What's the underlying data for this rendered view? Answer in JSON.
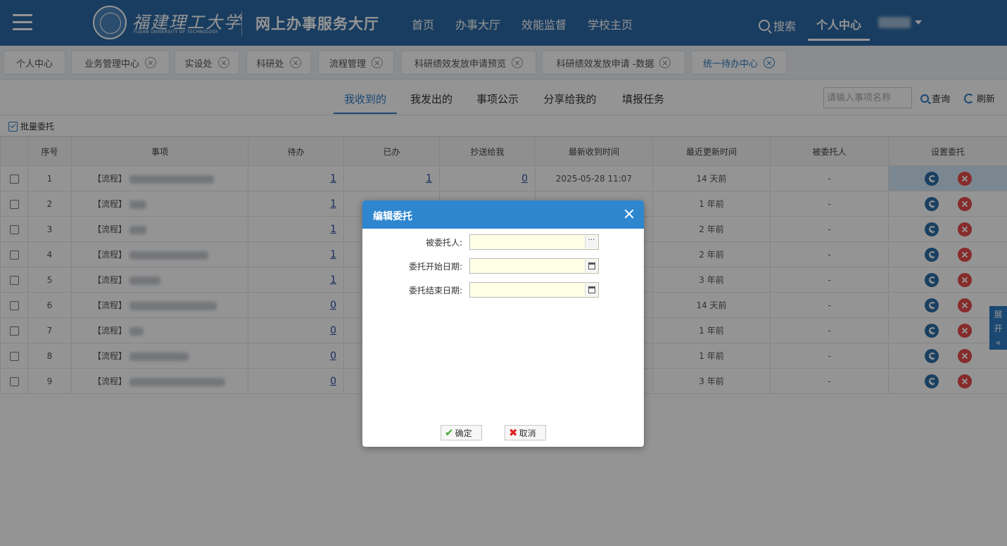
{
  "header": {
    "logo_cn": "福建理工大学",
    "logo_en": "FUJIAN UNIVERSITY OF TECHNOLOGY",
    "app_title": "网上办事服务大厅",
    "nav": [
      "首页",
      "办事大厅",
      "效能监督",
      "学校主页"
    ],
    "search_label": "搜索",
    "personal_center": "个人中心"
  },
  "tabs": [
    {
      "label": "个人中心",
      "closable": false
    },
    {
      "label": "业务管理中心",
      "closable": true
    },
    {
      "label": "实设处",
      "closable": true
    },
    {
      "label": "科研处",
      "closable": true
    },
    {
      "label": "流程管理",
      "closable": true
    },
    {
      "label": "科研绩效发放申请预览",
      "closable": true
    },
    {
      "label": "科研绩效发放申请 -数据",
      "closable": true
    },
    {
      "label": "统一待办中心",
      "closable": true,
      "active": true
    }
  ],
  "subnav": {
    "tabs": [
      "我收到的",
      "我发出的",
      "事项公示",
      "分享给我的",
      "填报任务"
    ],
    "active": "我收到的",
    "search_placeholder": "请输入事项名称",
    "query_label": "查询",
    "refresh_label": "刷新"
  },
  "toolbar": {
    "batch_label": "批量委托"
  },
  "table": {
    "headers": [
      "序号",
      "事项",
      "待办",
      "已办",
      "抄送给我",
      "最新收到时间",
      "最近更新时间",
      "被委托人",
      "设置委托"
    ],
    "rows": [
      {
        "seq": "1",
        "item": "【流程】",
        "todo": "1",
        "done": "1",
        "cc": "0",
        "received": "2025-05-28 11:07",
        "updated": "14 天前",
        "delegate": "-"
      },
      {
        "seq": "2",
        "item": "【流程】",
        "todo": "1",
        "done": "",
        "cc": "",
        "received": "",
        "updated": "1 年前",
        "delegate": "-"
      },
      {
        "seq": "3",
        "item": "【流程】",
        "todo": "1",
        "done": "",
        "cc": "",
        "received": "",
        "updated": "2 年前",
        "delegate": "-"
      },
      {
        "seq": "4",
        "item": "【流程】",
        "todo": "1",
        "done": "",
        "cc": "",
        "received": "",
        "updated": "2 年前",
        "delegate": "-"
      },
      {
        "seq": "5",
        "item": "【流程】",
        "todo": "1",
        "done": "",
        "cc": "",
        "received": "",
        "updated": "3 年前",
        "delegate": "-"
      },
      {
        "seq": "6",
        "item": "【流程】",
        "todo": "0",
        "done": "",
        "cc": "",
        "received": "",
        "updated": "14 天前",
        "delegate": "-"
      },
      {
        "seq": "7",
        "item": "【流程】",
        "todo": "0",
        "done": "",
        "cc": "",
        "received": "",
        "updated": "1 年前",
        "delegate": "-"
      },
      {
        "seq": "8",
        "item": "【流程】",
        "todo": "0",
        "done": "",
        "cc": "",
        "received": "",
        "updated": "1 年前",
        "delegate": "-"
      },
      {
        "seq": "9",
        "item": "【流程】",
        "todo": "0",
        "done": "",
        "cc": "",
        "received": "",
        "updated": "3 年前",
        "delegate": "-"
      }
    ]
  },
  "side_tab": {
    "line1": "展",
    "line2": "开",
    "chevrons": "«"
  },
  "dialog": {
    "title": "编辑委托",
    "fields": [
      {
        "label": "被委托人:",
        "value": "",
        "button": "···"
      },
      {
        "label": "委托开始日期:",
        "value": ""
      },
      {
        "label": "委托结束日期:",
        "value": ""
      }
    ],
    "ok_label": "确定",
    "cancel_label": "取消"
  },
  "colors": {
    "header_bg": "#2b6aa6",
    "accent": "#2e7cc4",
    "dialog_head": "#2e86cf",
    "danger": "#e84b4b"
  }
}
